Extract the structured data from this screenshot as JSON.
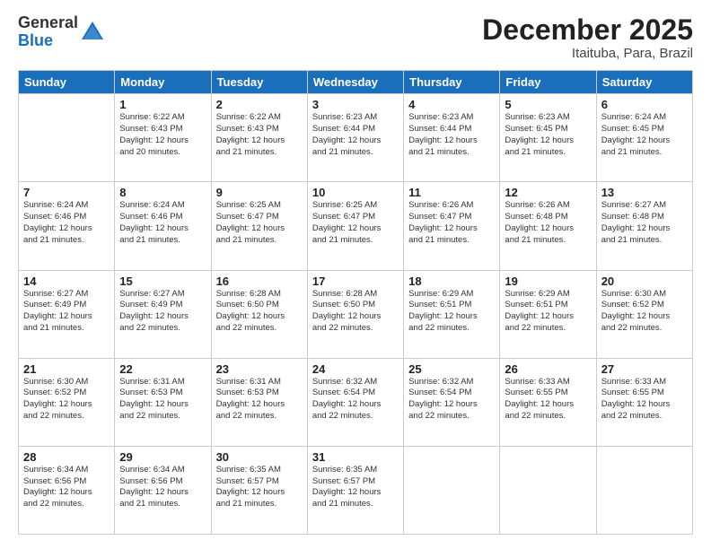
{
  "logo": {
    "general": "General",
    "blue": "Blue"
  },
  "title": "December 2025",
  "subtitle": "Itaituba, Para, Brazil",
  "days_header": [
    "Sunday",
    "Monday",
    "Tuesday",
    "Wednesday",
    "Thursday",
    "Friday",
    "Saturday"
  ],
  "weeks": [
    [
      {
        "day": "",
        "sunrise": "",
        "sunset": "",
        "daylight": ""
      },
      {
        "day": "1",
        "sunrise": "Sunrise: 6:22 AM",
        "sunset": "Sunset: 6:43 PM",
        "daylight": "Daylight: 12 hours and 20 minutes."
      },
      {
        "day": "2",
        "sunrise": "Sunrise: 6:22 AM",
        "sunset": "Sunset: 6:43 PM",
        "daylight": "Daylight: 12 hours and 21 minutes."
      },
      {
        "day": "3",
        "sunrise": "Sunrise: 6:23 AM",
        "sunset": "Sunset: 6:44 PM",
        "daylight": "Daylight: 12 hours and 21 minutes."
      },
      {
        "day": "4",
        "sunrise": "Sunrise: 6:23 AM",
        "sunset": "Sunset: 6:44 PM",
        "daylight": "Daylight: 12 hours and 21 minutes."
      },
      {
        "day": "5",
        "sunrise": "Sunrise: 6:23 AM",
        "sunset": "Sunset: 6:45 PM",
        "daylight": "Daylight: 12 hours and 21 minutes."
      },
      {
        "day": "6",
        "sunrise": "Sunrise: 6:24 AM",
        "sunset": "Sunset: 6:45 PM",
        "daylight": "Daylight: 12 hours and 21 minutes."
      }
    ],
    [
      {
        "day": "7",
        "sunrise": "Sunrise: 6:24 AM",
        "sunset": "Sunset: 6:46 PM",
        "daylight": "Daylight: 12 hours and 21 minutes."
      },
      {
        "day": "8",
        "sunrise": "Sunrise: 6:24 AM",
        "sunset": "Sunset: 6:46 PM",
        "daylight": "Daylight: 12 hours and 21 minutes."
      },
      {
        "day": "9",
        "sunrise": "Sunrise: 6:25 AM",
        "sunset": "Sunset: 6:47 PM",
        "daylight": "Daylight: 12 hours and 21 minutes."
      },
      {
        "day": "10",
        "sunrise": "Sunrise: 6:25 AM",
        "sunset": "Sunset: 6:47 PM",
        "daylight": "Daylight: 12 hours and 21 minutes."
      },
      {
        "day": "11",
        "sunrise": "Sunrise: 6:26 AM",
        "sunset": "Sunset: 6:47 PM",
        "daylight": "Daylight: 12 hours and 21 minutes."
      },
      {
        "day": "12",
        "sunrise": "Sunrise: 6:26 AM",
        "sunset": "Sunset: 6:48 PM",
        "daylight": "Daylight: 12 hours and 21 minutes."
      },
      {
        "day": "13",
        "sunrise": "Sunrise: 6:27 AM",
        "sunset": "Sunset: 6:48 PM",
        "daylight": "Daylight: 12 hours and 21 minutes."
      }
    ],
    [
      {
        "day": "14",
        "sunrise": "Sunrise: 6:27 AM",
        "sunset": "Sunset: 6:49 PM",
        "daylight": "Daylight: 12 hours and 21 minutes."
      },
      {
        "day": "15",
        "sunrise": "Sunrise: 6:27 AM",
        "sunset": "Sunset: 6:49 PM",
        "daylight": "Daylight: 12 hours and 22 minutes."
      },
      {
        "day": "16",
        "sunrise": "Sunrise: 6:28 AM",
        "sunset": "Sunset: 6:50 PM",
        "daylight": "Daylight: 12 hours and 22 minutes."
      },
      {
        "day": "17",
        "sunrise": "Sunrise: 6:28 AM",
        "sunset": "Sunset: 6:50 PM",
        "daylight": "Daylight: 12 hours and 22 minutes."
      },
      {
        "day": "18",
        "sunrise": "Sunrise: 6:29 AM",
        "sunset": "Sunset: 6:51 PM",
        "daylight": "Daylight: 12 hours and 22 minutes."
      },
      {
        "day": "19",
        "sunrise": "Sunrise: 6:29 AM",
        "sunset": "Sunset: 6:51 PM",
        "daylight": "Daylight: 12 hours and 22 minutes."
      },
      {
        "day": "20",
        "sunrise": "Sunrise: 6:30 AM",
        "sunset": "Sunset: 6:52 PM",
        "daylight": "Daylight: 12 hours and 22 minutes."
      }
    ],
    [
      {
        "day": "21",
        "sunrise": "Sunrise: 6:30 AM",
        "sunset": "Sunset: 6:52 PM",
        "daylight": "Daylight: 12 hours and 22 minutes."
      },
      {
        "day": "22",
        "sunrise": "Sunrise: 6:31 AM",
        "sunset": "Sunset: 6:53 PM",
        "daylight": "Daylight: 12 hours and 22 minutes."
      },
      {
        "day": "23",
        "sunrise": "Sunrise: 6:31 AM",
        "sunset": "Sunset: 6:53 PM",
        "daylight": "Daylight: 12 hours and 22 minutes."
      },
      {
        "day": "24",
        "sunrise": "Sunrise: 6:32 AM",
        "sunset": "Sunset: 6:54 PM",
        "daylight": "Daylight: 12 hours and 22 minutes."
      },
      {
        "day": "25",
        "sunrise": "Sunrise: 6:32 AM",
        "sunset": "Sunset: 6:54 PM",
        "daylight": "Daylight: 12 hours and 22 minutes."
      },
      {
        "day": "26",
        "sunrise": "Sunrise: 6:33 AM",
        "sunset": "Sunset: 6:55 PM",
        "daylight": "Daylight: 12 hours and 22 minutes."
      },
      {
        "day": "27",
        "sunrise": "Sunrise: 6:33 AM",
        "sunset": "Sunset: 6:55 PM",
        "daylight": "Daylight: 12 hours and 22 minutes."
      }
    ],
    [
      {
        "day": "28",
        "sunrise": "Sunrise: 6:34 AM",
        "sunset": "Sunset: 6:56 PM",
        "daylight": "Daylight: 12 hours and 22 minutes."
      },
      {
        "day": "29",
        "sunrise": "Sunrise: 6:34 AM",
        "sunset": "Sunset: 6:56 PM",
        "daylight": "Daylight: 12 hours and 21 minutes."
      },
      {
        "day": "30",
        "sunrise": "Sunrise: 6:35 AM",
        "sunset": "Sunset: 6:57 PM",
        "daylight": "Daylight: 12 hours and 21 minutes."
      },
      {
        "day": "31",
        "sunrise": "Sunrise: 6:35 AM",
        "sunset": "Sunset: 6:57 PM",
        "daylight": "Daylight: 12 hours and 21 minutes."
      },
      {
        "day": "",
        "sunrise": "",
        "sunset": "",
        "daylight": ""
      },
      {
        "day": "",
        "sunrise": "",
        "sunset": "",
        "daylight": ""
      },
      {
        "day": "",
        "sunrise": "",
        "sunset": "",
        "daylight": ""
      }
    ]
  ]
}
